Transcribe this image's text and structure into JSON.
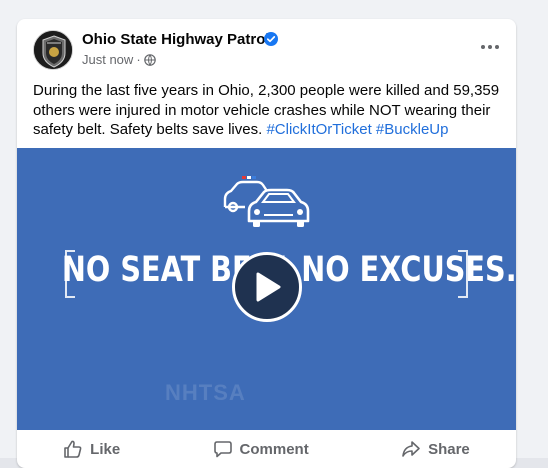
{
  "post": {
    "page_name": "Ohio State Highway Patrol",
    "timestamp": "Just now",
    "privacy_icon": "globe-icon",
    "text": "During the last five years in Ohio, 2,300 people were killed and 59,359 others were injured in motor vehicle crashes while NOT wearing their safety belt. Safety belts save lives. ",
    "hashtags": [
      "#ClickItOrTicket",
      "#BuckleUp"
    ]
  },
  "media": {
    "slogan": "NO SEAT BELT. NO EXCUSES.",
    "watermark": "NHTSA",
    "background_color": "#3e6cb7"
  },
  "actions": {
    "like": "Like",
    "comment": "Comment",
    "share": "Share"
  },
  "colors": {
    "verified": "#1877f2",
    "hashtag": "#216fdb",
    "secondary_text": "#65676b"
  }
}
